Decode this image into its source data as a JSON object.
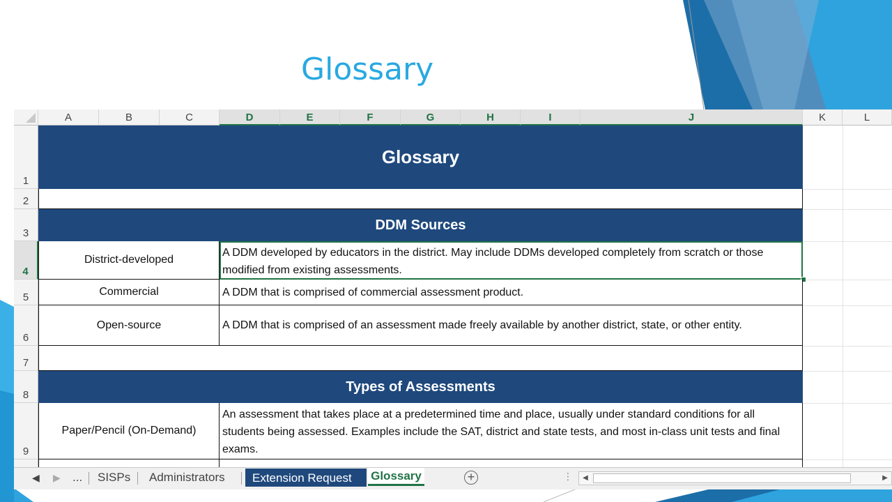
{
  "slide": {
    "title": "Glossary"
  },
  "colors": {
    "banner": "#1f497d",
    "accent": "#217346",
    "title": "#29a9e0"
  },
  "columns": [
    {
      "label": "A",
      "selected": false
    },
    {
      "label": "B",
      "selected": false
    },
    {
      "label": "C",
      "selected": false
    },
    {
      "label": "D",
      "selected": true
    },
    {
      "label": "E",
      "selected": true
    },
    {
      "label": "F",
      "selected": true
    },
    {
      "label": "G",
      "selected": true
    },
    {
      "label": "H",
      "selected": true
    },
    {
      "label": "I",
      "selected": true
    },
    {
      "label": "J",
      "selected": true
    },
    {
      "label": "K",
      "selected": false
    },
    {
      "label": "L",
      "selected": false
    }
  ],
  "rows": [
    {
      "label": "1",
      "selected": false
    },
    {
      "label": "2",
      "selected": false
    },
    {
      "label": "3",
      "selected": false
    },
    {
      "label": "4",
      "selected": true
    },
    {
      "label": "5",
      "selected": false
    },
    {
      "label": "6",
      "selected": false
    },
    {
      "label": "7",
      "selected": false
    },
    {
      "label": "8",
      "selected": false
    },
    {
      "label": "9",
      "selected": false
    }
  ],
  "sheet": {
    "main_heading": "Glossary",
    "sections": [
      {
        "heading": "DDM Sources",
        "entries": [
          {
            "term": "District-developed",
            "definition": "A DDM developed by educators in the district.  May include DDMs developed completely from scratch or those modified from existing assessments."
          },
          {
            "term": "Commercial",
            "definition": "A DDM that is comprised of commercial assessment product."
          },
          {
            "term": "Open-source",
            "definition": "A DDM that is comprised of  an assessment made freely available by another district, state, or other entity."
          }
        ]
      },
      {
        "heading": "Types of Assessments",
        "entries": [
          {
            "term": "Paper/Pencil (On-Demand)",
            "definition": "An assessment that takes place at a predetermined time and place, usually under standard conditions for all students being assessed.  Examples include the SAT, district and state tests, and most in-class unit tests and final exams."
          }
        ]
      }
    ]
  },
  "tabs": {
    "ellipsis": "...",
    "items": [
      {
        "label": "SISPs",
        "state": "normal"
      },
      {
        "label": "Administrators",
        "state": "normal"
      },
      {
        "label": "Extension Request",
        "state": "colored"
      },
      {
        "label": "Glossary",
        "state": "active"
      }
    ],
    "add": "+",
    "dots": "⋮"
  }
}
